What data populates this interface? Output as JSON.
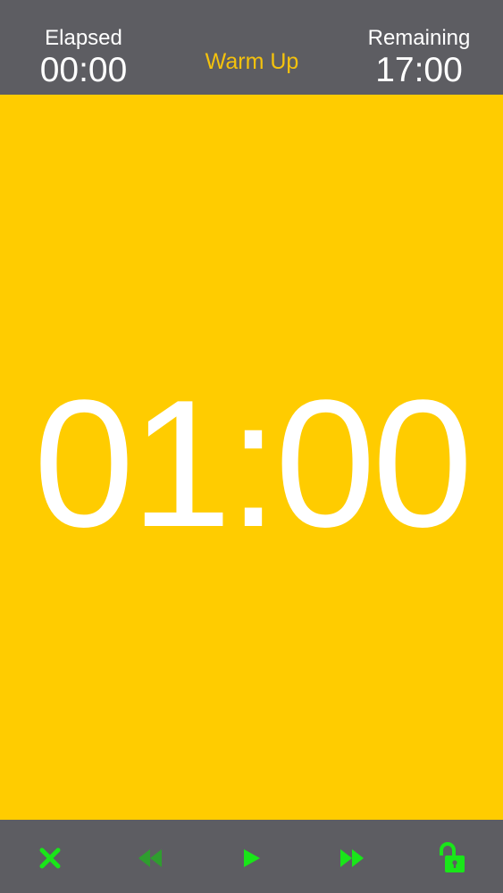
{
  "header": {
    "elapsed_label": "Elapsed",
    "elapsed_value": "00:00",
    "phase_name": "Warm Up",
    "remaining_label": "Remaining",
    "remaining_value": "17:00"
  },
  "main": {
    "countdown": "01:00"
  },
  "toolbar": {
    "buttons": [
      {
        "icon": "close-icon",
        "state": "active"
      },
      {
        "icon": "rewind-icon",
        "state": "disabled"
      },
      {
        "icon": "play-icon",
        "state": "active"
      },
      {
        "icon": "fast-forward-icon",
        "state": "active"
      },
      {
        "icon": "unlock-icon",
        "state": "active"
      }
    ]
  },
  "colors": {
    "header_background": "#5d5d62",
    "main_background": "#ffcc00",
    "phase_text": "#f4c20d",
    "timer_text": "#ffffff",
    "icon_active": "#19e619",
    "icon_disabled": "#2f9e2f"
  }
}
